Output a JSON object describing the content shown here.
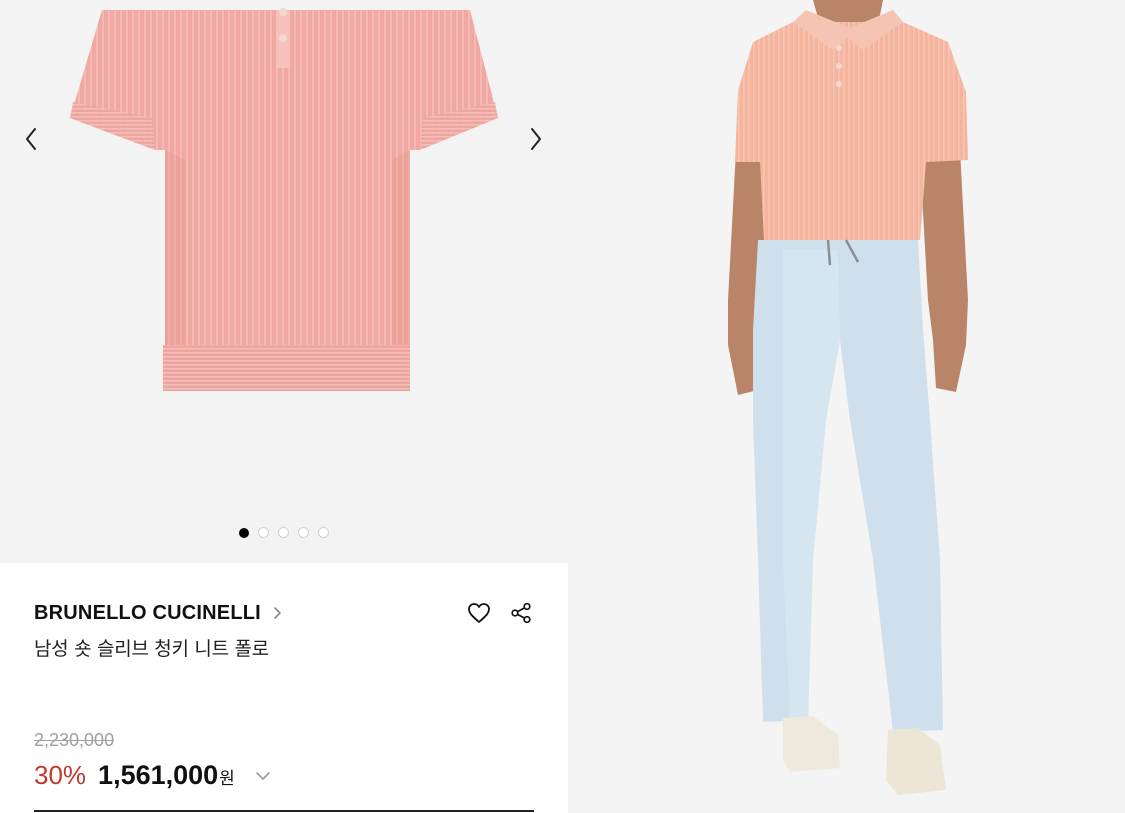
{
  "gallery": {
    "prev_icon": "chevron-left-icon",
    "next_icon": "chevron-right-icon",
    "dots": [
      {
        "active": true
      },
      {
        "active": false
      },
      {
        "active": false
      },
      {
        "active": false
      },
      {
        "active": false
      }
    ]
  },
  "product": {
    "brand": "BRUNELLO CUCINELLI",
    "name": "남성 숏 슬리브 청키 니트 폴로",
    "original_price": "2,230,000",
    "discount": "30%",
    "price": "1,561,000",
    "currency": "원"
  },
  "colors": {
    "accent_discount": "#c0392b",
    "shirt_pink": "#f2a9a3",
    "shirt_peach": "#f3b49c",
    "jeans_blue": "#cfe0ec"
  }
}
